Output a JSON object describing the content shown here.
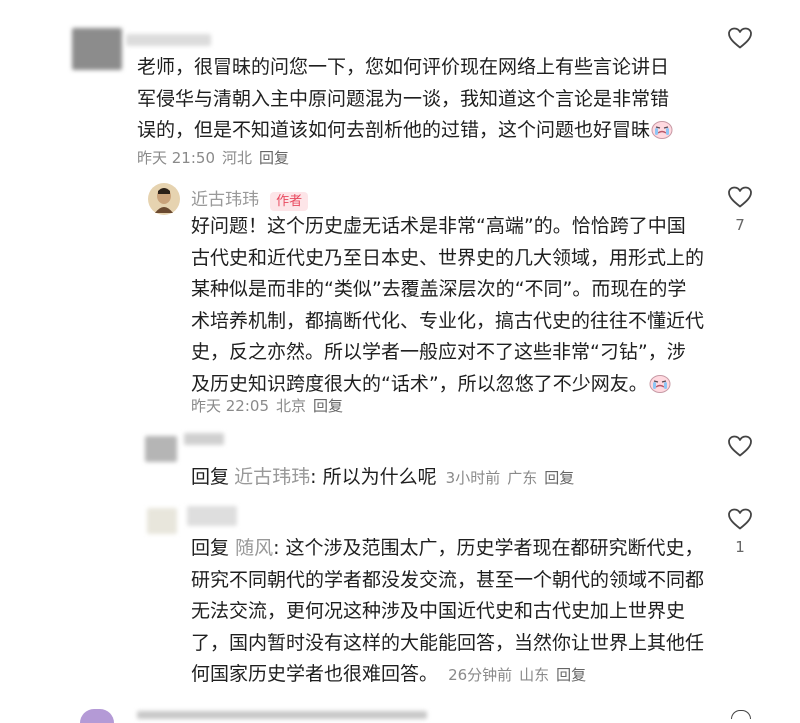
{
  "comment1": {
    "text": "老师，很冒昧的问您一下，您如何评价现在网络上有些言论讲日军侵华与清朝入主中原问题混为一谈，我知道这个言论是非常错误的，但是不知道该如何去剖析他的过错，这个问题也好冒昧",
    "time": "昨天 21:50",
    "location": "河北",
    "reply_label": "回复"
  },
  "reply1": {
    "author": "近古玮玮",
    "badge": "作者",
    "text": "好问题！这个历史虚无话术是非常“高端”的。恰恰跨了中国古代史和近代史乃至日本史、世界史的几大领域，用形式上的某种似是而非的“类似”去覆盖深层次的“不同”。而现在的学术培养机制，都搞断代化、专业化，搞古代史的往往不懂近代史，反之亦然。所以学者一般应对不了这些非常“刁钻”，涉及历史知识跨度很大的“话术”，所以忽悠了不少网友。",
    "time": "昨天 22:05",
    "location": "北京",
    "reply_label": "回复",
    "like_count": "7"
  },
  "reply2": {
    "prefix": "回复",
    "mention": "近古玮玮",
    "text": ": 所以为什么呢",
    "time": "3小时前",
    "location": "广东",
    "reply_label": "回复"
  },
  "reply3": {
    "prefix": "回复",
    "mention": "随风",
    "text": ": 这个涉及范围太广，历史学者现在都研究断代史，研究不同朝代的学者都没发交流，甚至一个朝代的领域不同都无法交流，更何况这种涉及中国近代史和古代史加上世界史了，国内暂时没有这样的大能能回答，当然你让世界上其他任何国家历史学者也很难回答。",
    "time": "26分钟前",
    "location": "山东",
    "reply_label": "回复",
    "like_count": "1"
  },
  "icons": {
    "like": "heart-outline-icon",
    "emoji": "crying-face-emoji"
  },
  "colors": {
    "badge_text": "#e84a5f",
    "badge_bg": "#fde5e8",
    "meta": "#8a8a8a",
    "name": "#999999"
  }
}
